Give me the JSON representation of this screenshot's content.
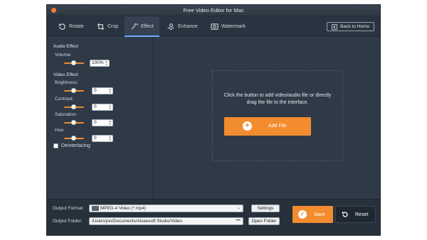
{
  "window": {
    "title": "Free Video Editor for Mac"
  },
  "toolbar": {
    "tabs": [
      {
        "label": "Rotate",
        "icon": "rotate-icon"
      },
      {
        "label": "Crop",
        "icon": "crop-icon"
      },
      {
        "label": "Effect",
        "icon": "effect-icon",
        "active": true
      },
      {
        "label": "Enhance",
        "icon": "enhance-icon"
      },
      {
        "label": "Watermark",
        "icon": "watermark-icon"
      }
    ],
    "back_label": "Back to Home"
  },
  "left_panel": {
    "audio_section": "Audio Effect",
    "volume": {
      "label": "Volume:",
      "value": "100%",
      "level": 0.5
    },
    "video_section": "Video Effect",
    "brightness": {
      "label": "Brightness:",
      "value": "0",
      "level": 0.5
    },
    "contrast": {
      "label": "Contrast:",
      "value": "0",
      "level": 0.5
    },
    "saturation": {
      "label": "Saturation:",
      "value": "0",
      "level": 0.5
    },
    "hue": {
      "label": "Hue:",
      "value": "0",
      "level": 0.5
    },
    "deinterlacing": {
      "label": "Deinterlacing",
      "checked": false
    }
  },
  "main": {
    "drop_line1": "Click the button to add video/audio file or directly",
    "drop_line2": "drag the file to the interface.",
    "add_file_label": "Add File"
  },
  "bottom": {
    "output_format_label": "Output Format:",
    "output_format_value": "MPEG-4 Video (*.mp4)",
    "settings_label": "Settings",
    "output_folder_label": "Output Folder:",
    "output_folder_value": "/Users/jon/Documents/Aiseesoft Studio/Video",
    "browse_label": "•••",
    "open_folder_label": "Open Folder",
    "save_label": "Save",
    "reset_label": "Reset"
  },
  "colors": {
    "accent": "#f28c2e",
    "panel": "#2f3a47",
    "active_tab_underline": "#6fa8ff"
  }
}
